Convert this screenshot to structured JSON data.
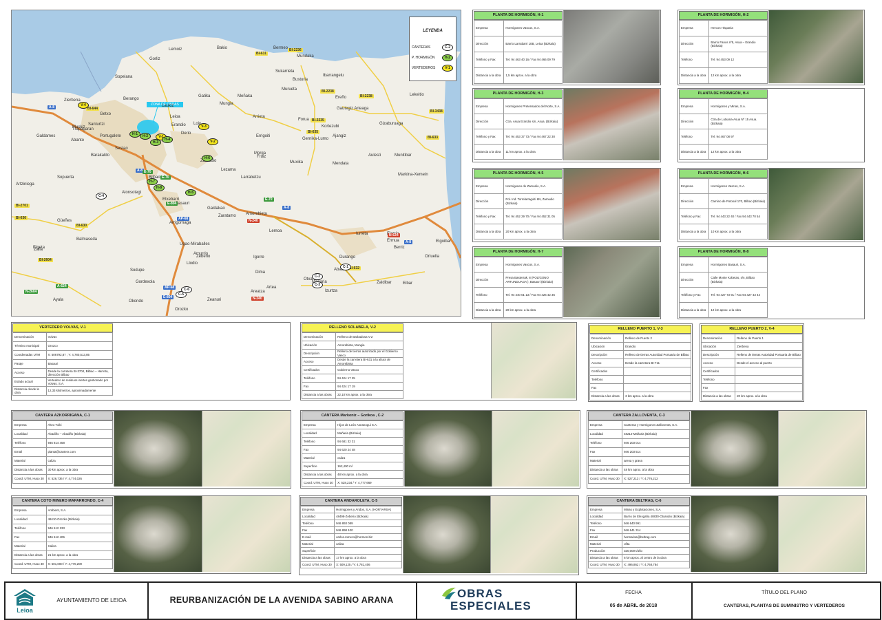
{
  "map": {
    "legend": {
      "title": "LEYENDA",
      "items": [
        {
          "label": "CANTERAS",
          "code": "C-2"
        },
        {
          "label": "P. HORMIGÓN",
          "code": "H-2"
        },
        {
          "label": "VERTEDEROS",
          "code": "V-1"
        }
      ]
    },
    "callout": "ZONA DE OBRAS",
    "places": [
      "Sopelana",
      "Gorliz",
      "Lemoiz",
      "Bakio",
      "Bermeo",
      "Mundaka",
      "Sukarrieta",
      "Busturia",
      "Ibarrangelu",
      "Murueta",
      "Laukiz",
      "Gatika",
      "Mungia",
      "Meñaka",
      "Arrieta",
      "Forua",
      "Kortezubi",
      "Ereño",
      "Lekeitio",
      "Gautegiz Arteaga",
      "Errigoiti",
      "Gernika-Lumo",
      "Ajangiz",
      "Gizaburuaga",
      "Berango",
      "Leioa",
      "Erandio",
      "Loiu",
      "Derio",
      "Zamudio",
      "Lezama",
      "Larrabetzu",
      "Fruiz",
      "Morga",
      "Muxika",
      "Mendata",
      "Aulesti",
      "Munitibar",
      "Markina-Xemein",
      "Zierbena",
      "Santurtzi",
      "Portugalete",
      "Barakaldo",
      "Sestao",
      "Getxo",
      "Bilbao",
      "Basauri",
      "Galdakao",
      "Etxebarri",
      "Arrigorriaga",
      "Ugao-Miraballes",
      "Zeberio",
      "Amorebieta",
      "Lemoa",
      "Igorre",
      "Dima",
      "Otxandio",
      "Durango",
      "Abadiño",
      "Iurreta",
      "Elorrio",
      "Berriz",
      "Zaldibar",
      "Ermua",
      "Mañaria",
      "Izurtza",
      "Orozko",
      "Zeanuri",
      "Areatza",
      "Artea",
      "Zaratamo",
      "Alonsotegi",
      "Güeñes",
      "Zalla",
      "Balmaseda",
      "Sodupe",
      "Gordexola",
      "Okondo",
      "Llodio",
      "Amurrio",
      "Arrankudiaga",
      "Ayala",
      "Artziniega",
      "Sopuerta",
      "Galdames",
      "Muskiz",
      "Abanto",
      "Trapagaran",
      "Ortuella",
      "Elgoibar",
      "Eibar",
      "Elgeta"
    ],
    "roads": [
      {
        "t": "BI-631",
        "c": "yellow"
      },
      {
        "t": "BI-2236",
        "c": "yellow"
      },
      {
        "t": "BI-2238",
        "c": "yellow"
      },
      {
        "t": "BI-2238",
        "c": "yellow"
      },
      {
        "t": "BI-3438",
        "c": "yellow"
      },
      {
        "t": "BI-644",
        "c": "yellow"
      },
      {
        "t": "BI-2235",
        "c": "yellow"
      },
      {
        "t": "BI-635",
        "c": "yellow"
      },
      {
        "t": "BI-633",
        "c": "yellow"
      },
      {
        "t": "A-8",
        "c": "blue"
      },
      {
        "t": "A-8",
        "c": "blue"
      },
      {
        "t": "A-8",
        "c": "blue"
      },
      {
        "t": "E-70",
        "c": "green"
      },
      {
        "t": "E-70",
        "c": "green"
      },
      {
        "t": "E-804",
        "c": "green"
      },
      {
        "t": "AP-68",
        "c": "blue"
      },
      {
        "t": "N-240",
        "c": "red"
      },
      {
        "t": "N-634",
        "c": "red"
      },
      {
        "t": "BI-2701",
        "c": "yellow"
      },
      {
        "t": "BI-636",
        "c": "yellow"
      },
      {
        "t": "BI-630",
        "c": "yellow"
      },
      {
        "t": "BI-2604",
        "c": "yellow"
      },
      {
        "t": "A-624",
        "c": "green"
      },
      {
        "t": "N-2604",
        "c": "green"
      },
      {
        "t": "BI-632",
        "c": "yellow"
      },
      {
        "t": "AP-68",
        "c": "blue"
      },
      {
        "t": "E-804",
        "c": "blue"
      },
      {
        "t": "N-240",
        "c": "red"
      },
      {
        "t": "A-8",
        "c": "blue"
      },
      {
        "t": "E-70",
        "c": "green"
      }
    ],
    "markers": [
      {
        "code": "V-4",
        "kind": "v"
      },
      {
        "code": "V-3",
        "kind": "v"
      },
      {
        "code": "V-1",
        "kind": "v"
      },
      {
        "code": "V-2",
        "kind": "v"
      },
      {
        "code": "H-1",
        "kind": "h"
      },
      {
        "code": "H-2",
        "kind": "h"
      },
      {
        "code": "H-4",
        "kind": "h"
      },
      {
        "code": "H-3",
        "kind": "h"
      },
      {
        "code": "H-7",
        "kind": "h"
      },
      {
        "code": "H-8",
        "kind": "h"
      },
      {
        "code": "H-5",
        "kind": "h"
      },
      {
        "code": "H-6",
        "kind": "h"
      },
      {
        "code": "C-4",
        "kind": "c"
      },
      {
        "code": "C-1",
        "kind": "c"
      },
      {
        "code": "C-2",
        "kind": "c"
      },
      {
        "code": "C-3",
        "kind": "c"
      },
      {
        "code": "C-5",
        "kind": "c"
      },
      {
        "code": "C-6",
        "kind": "c"
      }
    ]
  },
  "plants": [
    {
      "title": "PLANTA DE HORMIGÓN, H-1",
      "rows": [
        [
          "Empresa",
          "Hormigones Vascos, S.A."
        ],
        [
          "Dirección",
          "Barrio Larrabarri 10B, Leioa (Bizkaia)"
        ],
        [
          "Teléfono y Fax",
          "Tel. 94 463 40 16 / Fax 94 466 09 79"
        ],
        [
          "Distancia a la obra",
          "1,5 km aprox. a la obra"
        ]
      ]
    },
    {
      "title": "PLANTA DE HORMIGÓN, H-2",
      "rows": [
        [
          "Empresa",
          "Hercon Hispania"
        ],
        [
          "Dirección",
          "Barrio Fanos nº5, Asua – Erandio (Bizkaia)"
        ],
        [
          "Teléfono",
          "Tel. 94 453 09 12"
        ],
        [
          "Distancia a la obra",
          "12 km aprox. a la obra"
        ]
      ]
    },
    {
      "title": "PLANTA DE HORMIGÓN, H-3",
      "rows": [
        [
          "Empresa",
          "Hormigones Pretensados del Norte, S.A."
        ],
        [
          "Dirección",
          "Ctra. Asua Erandio s/n, Asua. (Bizkaia)"
        ],
        [
          "Teléfono y Fax",
          "Tel. 94 453 37 73 / Fax 94 467 22 30"
        ],
        [
          "Distancia a la obra",
          "11 km aprox. a la obra"
        ]
      ]
    },
    {
      "title": "PLANTA DE HORMIGÓN, H-4",
      "rows": [
        [
          "Empresa",
          "Hormigones y Minas, S.A."
        ],
        [
          "Dirección",
          "Ctra de Lutxana-Asua Nº 15 Asua. (Bizkaia)"
        ],
        [
          "Teléfono",
          "Tel. 94 467 08 97"
        ],
        [
          "Distancia a la obra",
          "12 km aprox. a la obra"
        ]
      ]
    },
    {
      "title": "PLANTA DE HORMIGÓN, H-5",
      "rows": [
        [
          "Empresa",
          "Hormigones de Zamudio, S.A."
        ],
        [
          "Dirección",
          "Pol. Ind. Torrelarragoiti 6N, Zamudio (Bizkaia)"
        ],
        [
          "Teléfono y Fax",
          "Tel. 94 452 29 70 / Fax 94 452 31 05"
        ],
        [
          "Distancia a la obra",
          "20 km aprox. a la obra"
        ]
      ]
    },
    {
      "title": "PLANTA DE HORMIGÓN, H-6",
      "rows": [
        [
          "Empresa",
          "Hormigones Vascos, S.A."
        ],
        [
          "Dirección",
          "Camino de Potosol 170, Bilbao (Bizkaia)"
        ],
        [
          "Teléfono y Fax",
          "Tel. 94 443 22 40 / Fax 94 443 70 54"
        ],
        [
          "Distancia a la obra",
          "10 km aprox. a la obra"
        ]
      ]
    },
    {
      "title": "PLANTA DE HORMIGÓN, H-7",
      "rows": [
        [
          "Empresa",
          "Hormigones Vascos, S.A."
        ],
        [
          "Dirección",
          "Presa Basterrak, 8 (POLÍGONO ARTUNDUAGA ), Basauri (Bizkaia)"
        ],
        [
          "Teléfono",
          "Tel. 94 440 01 13 / Fax 94 426 42 36"
        ],
        [
          "Distancia a la obra",
          "20 km aprox. a la obra"
        ]
      ]
    },
    {
      "title": "PLANTA DE HORMIGÓN, H-8",
      "rows": [
        [
          "Empresa",
          "Hormigones Basauri, S.A."
        ],
        [
          "Dirección",
          "Calle Monte Kobetas, s/n, Bilbao (Bizkaia)"
        ],
        [
          "Teléfono y Fax",
          "Tel. 94 427 73 91 / Fax 94 427 43 44"
        ],
        [
          "Distancia a la obra",
          "12 km aprox. a la obra"
        ]
      ]
    }
  ],
  "landfills": [
    {
      "title": "VERTEDERO VOLVAS, V-1",
      "rows": [
        [
          "Denominación",
          "Volvas"
        ],
        [
          "Término municipal",
          "Orozco"
        ],
        [
          "Coordenadas UTM",
          "X: 506792,87 ; Y: 4,780,513,85"
        ],
        [
          "Paraje",
          "Basauri"
        ],
        [
          "Acceso",
          "Desde la carretera BI-3704, Bilbao – Harreta, dirección Bilbao"
        ],
        [
          "Estado actual",
          "Vertedero de residuos inertes gestionado por Volvas, S.A."
        ],
        [
          "Distancia desde la obra",
          "12,33 kilómetros, aproximadamente"
        ]
      ]
    },
    {
      "title": "RELLENO SOLABELA, V-2",
      "rows": [
        [
          "Denominación",
          "Relleno de Barbadosa V-2"
        ],
        [
          "Ubicación",
          "Amorebieta, Mungia"
        ],
        [
          "Descripción",
          "Relleno de tierras autorizado por el Gobierno Vasco"
        ],
        [
          "Acceso",
          "Desde la carretera BI-631 a la altura de Amorebieta"
        ],
        [
          "Certificados",
          "Gobierno Vasco"
        ],
        [
          "Teléfono",
          "94 424 17 25"
        ],
        [
          "Fax",
          "94 424 17 19"
        ],
        [
          "Distancia a las obras",
          "22,10 km aprox. a la obra"
        ]
      ]
    },
    {
      "title": "RELLENO PUERTO 1, V-3",
      "rows": [
        [
          "Denominación",
          "Relleno de Puerto 2"
        ],
        [
          "Ubicación",
          "Erandio"
        ],
        [
          "Descripción",
          "Relleno de tierras Autoridad Portuaria de Bilbao"
        ],
        [
          "Acceso",
          "Desde la carretera BI-711"
        ],
        [
          "Certificados",
          ""
        ],
        [
          "Teléfono",
          ""
        ],
        [
          "Fax",
          ""
        ],
        [
          "Distancia a las obras",
          "3 km aprox. a la obra"
        ]
      ]
    },
    {
      "title": "RELLENO PUERTO 2, V-4",
      "rows": [
        [
          "Denominación",
          "Relleno de Puerto 1"
        ],
        [
          "Ubicación",
          "Zierbena"
        ],
        [
          "Descripción",
          "Relleno de tierras Autoridad Portuaria de Bilbao"
        ],
        [
          "Acceso",
          "Desde el acceso al puerto"
        ],
        [
          "Certificados",
          ""
        ],
        [
          "Teléfono",
          ""
        ],
        [
          "Fax",
          ""
        ],
        [
          "Distancia a las obras",
          "20 km aprox. a la obra"
        ]
      ]
    }
  ],
  "quarries": [
    {
      "title": "CANTERA AZKORRIGANA, C-1",
      "rows": [
        [
          "Empresa",
          "Altzo Txiki"
        ],
        [
          "Localidad",
          "Abadiño – Abadiño (Bizkaia)"
        ],
        [
          "Teléfono",
          "946 814 458"
        ],
        [
          "Email",
          "planta@canterx.com"
        ],
        [
          "Material",
          "caliza"
        ],
        [
          "Distancia a las obras",
          "30 km aprox. a la obra"
        ],
        [
          "Coord. UTM, Huso 30",
          "X: 526,736 / Y: 4,774,026"
        ]
      ]
    },
    {
      "title": "CANTERA Markoniz – Gorikoa , C-2",
      "rows": [
        [
          "Empresa",
          "Hijos de León Aseanogui S.A."
        ],
        [
          "Localidad",
          "Mañaria (Bizkaia)"
        ],
        [
          "Teléfono",
          "94 681 32 31"
        ],
        [
          "Fax",
          "94 620 24 48"
        ],
        [
          "Material",
          "caliza"
        ],
        [
          "Superficie",
          "162,400 m²"
        ],
        [
          "Distancia a las obras",
          "48 km aprox. a la obra"
        ],
        [
          "Coord. UTM, Huso 30",
          "X: 528,234 / Y: 4,777,669"
        ]
      ]
    },
    {
      "title": "CANTERA ZALLOVENTA, C-3",
      "rows": [
        [
          "Empresa",
          "Canteras y Hormigones Zalloventa, S.A."
        ],
        [
          "Localidad",
          "48212-Mañaria (Bizkaia)"
        ],
        [
          "Teléfono",
          "946 203 014"
        ],
        [
          "Fax",
          "946 203 514"
        ],
        [
          "Material",
          "arena y grava"
        ],
        [
          "Distancia a las obras",
          "48 km aprox. a la obra"
        ],
        [
          "Coord. UTM, Huso 30",
          "X: 527,213 / Y: 4,776,212"
        ]
      ]
    },
    {
      "title": "CANTERA COTO MINERO MAPARRONDO, C-4",
      "rows": [
        [
          "Empresa",
          "Ambient, S.A."
        ],
        [
          "Localidad",
          "48410-Orozko (Bizkaia)"
        ],
        [
          "Teléfono",
          "946 612 233"
        ],
        [
          "Fax",
          "946 612 406"
        ],
        [
          "Material",
          "Caliza"
        ],
        [
          "Distancia a las obras",
          "21 km aprox. a la obra"
        ],
        [
          "Coord. UTM, Huso 30",
          "X: 501,000 / Y: 4,770,200"
        ]
      ]
    },
    {
      "title": "CANTERA ANDAROLETA, C-5",
      "rows": [
        [
          "Empresa",
          "Hormigones y Áridos, S.A. (HORYARSA)"
        ],
        [
          "Localidad",
          "48498-Zeberio (Bizkaia)"
        ],
        [
          "Teléfono",
          "946 893 089"
        ],
        [
          "Fax",
          "946 898 400"
        ],
        [
          "E-mail",
          "carlos.romero@hormon.biz"
        ],
        [
          "Material",
          "caliza"
        ],
        [
          "Superficie",
          ""
        ],
        [
          "Distancia a las obras",
          "17 km aprox. a la obra"
        ],
        [
          "Coord. UTM, Huso 30",
          "X: 509,125 / Y: 4,781,406"
        ]
      ]
    },
    {
      "title": "CANTERA BELTRAG, C-6",
      "rows": [
        [
          "Empresa",
          "Minas y Explotaciones, S.A."
        ],
        [
          "Localidad",
          "Barrio de Elexgaña 48830-Otxandio (Bizkaia)"
        ],
        [
          "Teléfono",
          "946 640 991"
        ],
        [
          "Fax",
          "946 641 314"
        ],
        [
          "Email",
          "hormarisa@beltrag.com"
        ],
        [
          "Material",
          "ofita"
        ],
        [
          "Producción",
          "320,000 t/año"
        ],
        [
          "Distancia a las obras",
          "6 km aprox. al centro de la obra"
        ],
        [
          "Coord. UTM, Huso 30",
          "X: 496,862 / Y: 4,768,784"
        ]
      ]
    }
  ],
  "footer": {
    "municipality": "AYUNTAMIENTO DE LEIOA",
    "logo_text": "Leioa",
    "project": "REURBANIZACIÓN DE LA AVENIDA SABINO ARANA",
    "company_line1": "OBRAS",
    "company_line2": "ESPECIALES",
    "date_label": "FECHA",
    "date": "05 de ABRIL de 2018",
    "plan_title_label": "TÍTULO DEL PLANO",
    "plan_title": "CANTERAS, PLANTAS DE SUMINISTRO Y VERTEDEROS",
    "colors": {
      "brand_green": "#8cc63f",
      "brand_navy": "#1f3c5a",
      "brand_teal": "#1d7a86"
    }
  }
}
